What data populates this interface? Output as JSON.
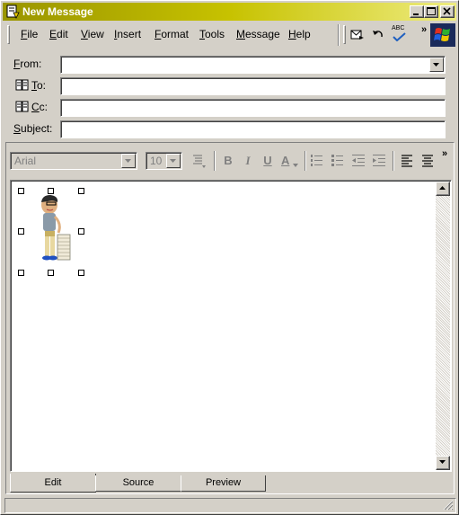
{
  "window": {
    "title": "New Message"
  },
  "menu": {
    "items": [
      {
        "label": "File",
        "ul": "F",
        "rest": "ile"
      },
      {
        "label": "Edit",
        "ul": "E",
        "rest": "dit"
      },
      {
        "label": "View",
        "ul": "V",
        "rest": "iew"
      },
      {
        "label": "Insert",
        "ul": "I",
        "rest": "nsert"
      },
      {
        "label": "Format",
        "ul": "F",
        "rest": "ormat"
      },
      {
        "label": "Tools",
        "ul": "T",
        "rest": "ools"
      },
      {
        "label": "Message",
        "ul": "M",
        "rest": "essage"
      },
      {
        "label": "Help",
        "ul": "H",
        "rest": "elp"
      }
    ],
    "more_glyph": "»",
    "toolbar_icons": [
      "send-icon",
      "undo-icon",
      "spell-check-icon"
    ],
    "spell_abbrev": "ABC"
  },
  "header": {
    "from": {
      "label": "From:",
      "ul": "F",
      "rest": "rom:",
      "value": ""
    },
    "to": {
      "label": "To:",
      "ul": "T",
      "rest": "o:",
      "value": ""
    },
    "cc": {
      "label": "Cc:",
      "ul": "C",
      "rest": "c:",
      "value": ""
    },
    "subject": {
      "label": "Subject:",
      "ul": "S",
      "rest": "ubject:",
      "value": ""
    }
  },
  "format_toolbar": {
    "font": "Arial",
    "size": "10",
    "bold": "B",
    "italic": "I",
    "underline": "U",
    "font_color": "A",
    "more_glyph": "»",
    "icons": [
      "paragraph-style-icon",
      "bold-icon",
      "italic-icon",
      "underline-icon",
      "font-color-icon",
      "numbered-list-icon",
      "bullet-list-icon",
      "decrease-indent-icon",
      "increase-indent-icon",
      "align-left-icon",
      "align-center-icon"
    ]
  },
  "tabs": [
    {
      "label": "Edit",
      "active": true
    },
    {
      "label": "Source",
      "active": false
    },
    {
      "label": "Preview",
      "active": false
    }
  ],
  "colors": {
    "titlebar_start": "#9a9500",
    "titlebar_end": "#eeec80",
    "face": "#d4d0c8"
  }
}
